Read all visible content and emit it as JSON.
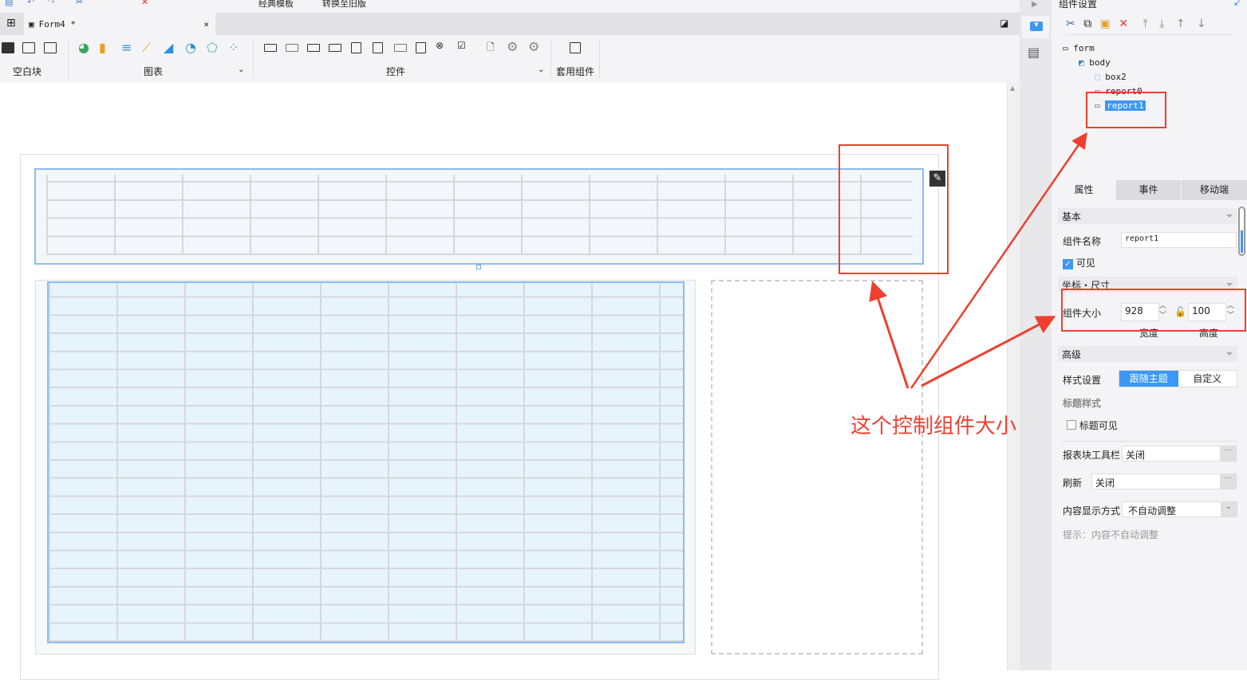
{
  "topbar": {
    "classic_template": "经典模板",
    "convert_old": "转换至旧版"
  },
  "tab": {
    "label": "Form4 *",
    "close": "×"
  },
  "ribbon": {
    "groups": [
      "空白块",
      "图表",
      "控件",
      "套用组件"
    ]
  },
  "panel": {
    "title": "组件设置",
    "tree": [
      "form",
      "body",
      "box2",
      "report0",
      "report1"
    ],
    "tabs": [
      "属性",
      "事件",
      "移动端"
    ],
    "basic": "基本",
    "name_label": "组件名称",
    "name_value": "report1",
    "visible": "可见",
    "coord_section": "坐标・尺寸",
    "size_label": "组件大小",
    "width": "928",
    "height": "100",
    "width_label": "宽度",
    "height_label": "高度",
    "advanced": "高级",
    "style_label": "样式设置",
    "style_options": [
      "跟随主题",
      "自定义"
    ],
    "title_style": "标题样式",
    "title_visible": "标题可见",
    "toolbar_label": "报表块工具栏",
    "toolbar_value": "关闭",
    "refresh_label": "刷新",
    "refresh_value": "关闭",
    "display_label": "内容显示方式",
    "display_value": "不自动调整",
    "hint": "提示：内容不自动调整"
  },
  "annotation": "这个控制组件大小",
  "colors": {
    "accent": "#3d97f5",
    "annotation": "#ee4030"
  }
}
